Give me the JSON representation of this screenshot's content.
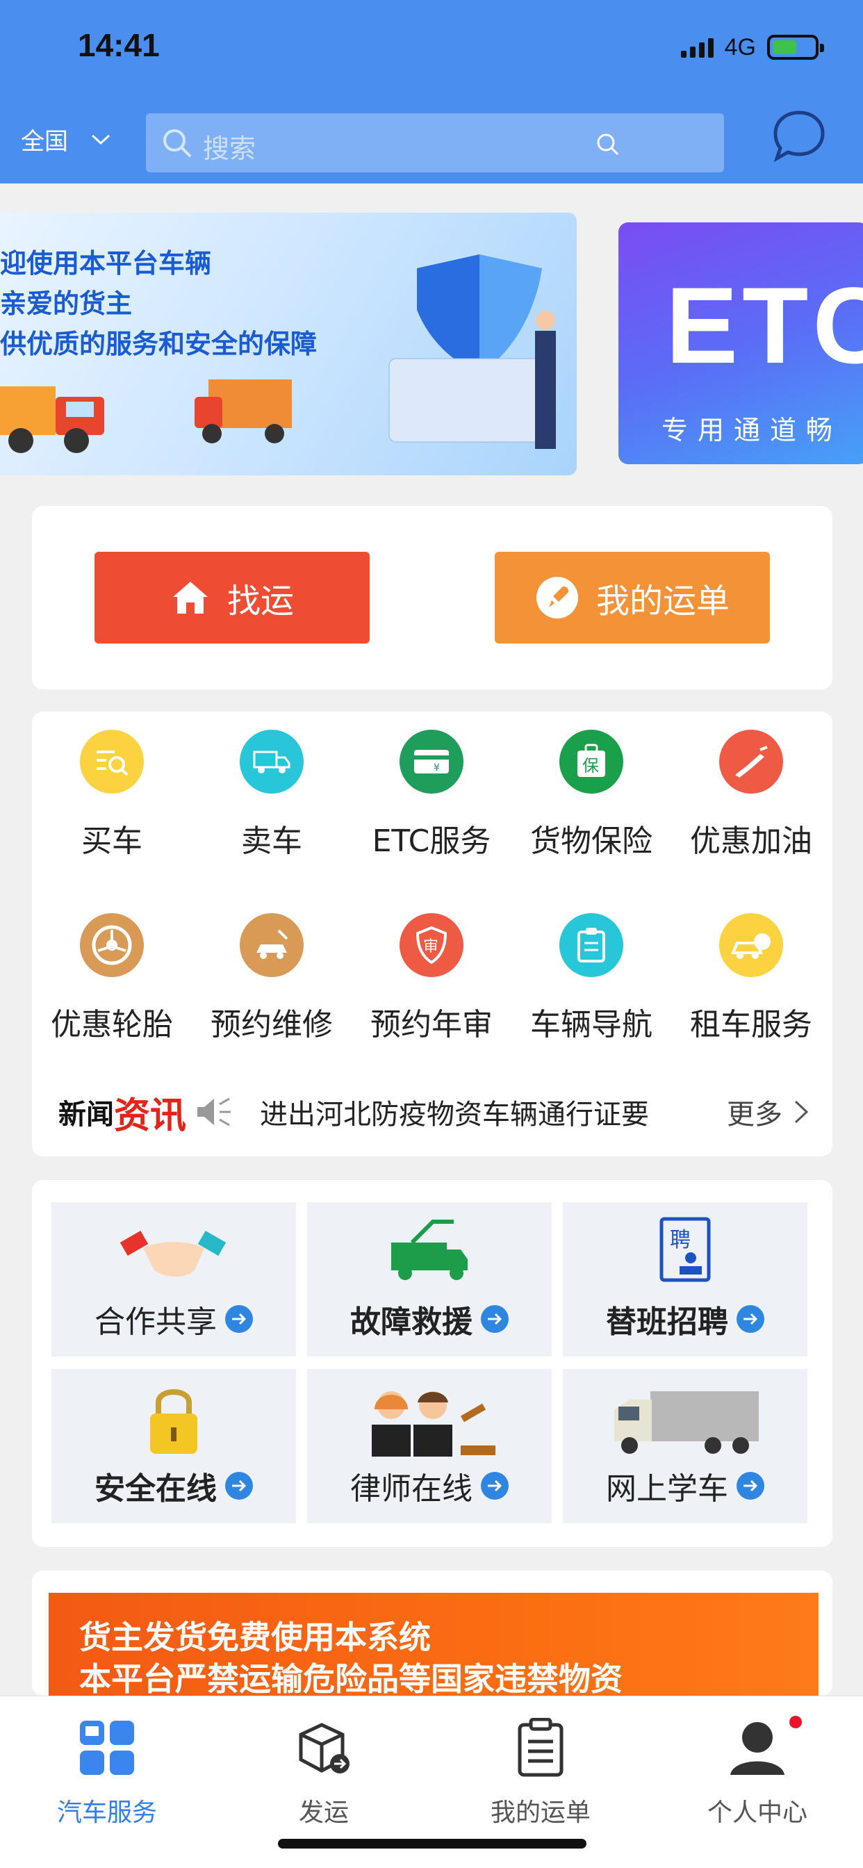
{
  "status": {
    "time": "14:41",
    "network": "4G"
  },
  "header": {
    "region": "全国",
    "search_placeholder": "搜索"
  },
  "banners": {
    "b1_lines": [
      "迎使用本平台车辆",
      "亲爱的货主",
      "供优质的服务和安全的保障"
    ],
    "b2_title": "ETC",
    "b2_sub": "专用通道畅"
  },
  "actions": {
    "find": "找运",
    "orders": "我的运单"
  },
  "services": [
    {
      "label": "买车",
      "icon": "search-doc-icon",
      "color": "#fdd240"
    },
    {
      "label": "卖车",
      "icon": "truck-icon",
      "color": "#27c6d9"
    },
    {
      "label": "ETC服务",
      "icon": "etc-card-icon",
      "color": "#1e9e5a"
    },
    {
      "label": "货物保险",
      "icon": "insurance-icon",
      "color": "#1aa04b"
    },
    {
      "label": "优惠加油",
      "icon": "fuel-nozzle-icon",
      "color": "#ee5a44"
    },
    {
      "label": "优惠轮胎",
      "icon": "tire-icon",
      "color": "#d99a55"
    },
    {
      "label": "预约维修",
      "icon": "repair-icon",
      "color": "#d99a55"
    },
    {
      "label": "预约年审",
      "icon": "inspection-shield-icon",
      "color": "#ee5a44"
    },
    {
      "label": "车辆导航",
      "icon": "clipboard-icon",
      "color": "#27c6d9"
    },
    {
      "label": "租车服务",
      "icon": "rent-car-icon",
      "color": "#fdd240"
    }
  ],
  "news": {
    "label_a": "新闻",
    "label_b": "资讯",
    "text": "进出河北防疫物资车辆通行证要",
    "more": "更多"
  },
  "features": [
    {
      "label": "合作共享",
      "icon": "handshake-icon"
    },
    {
      "label": "故障救援",
      "icon": "tow-truck-icon"
    },
    {
      "label": "替班招聘",
      "icon": "recruit-icon"
    },
    {
      "label": "安全在线",
      "icon": "padlock-icon"
    },
    {
      "label": "律师在线",
      "icon": "lawyers-icon"
    },
    {
      "label": "网上学车",
      "icon": "semi-truck-icon"
    }
  ],
  "notice": {
    "line1": "货主发货免费使用本系统",
    "line2": "本平台严禁运输危险品等国家违禁物资"
  },
  "tabs": [
    {
      "label": "汽车服务",
      "icon": "grid-icon",
      "active": true
    },
    {
      "label": "发运",
      "icon": "package-icon",
      "active": false
    },
    {
      "label": "我的运单",
      "icon": "clipboard-list-icon",
      "active": false
    },
    {
      "label": "个人中心",
      "icon": "user-icon",
      "active": false
    }
  ],
  "colors": {
    "primary": "#4a8ef0",
    "find": "#ee4d33",
    "orders": "#f39237",
    "notice": "#f35a14"
  }
}
